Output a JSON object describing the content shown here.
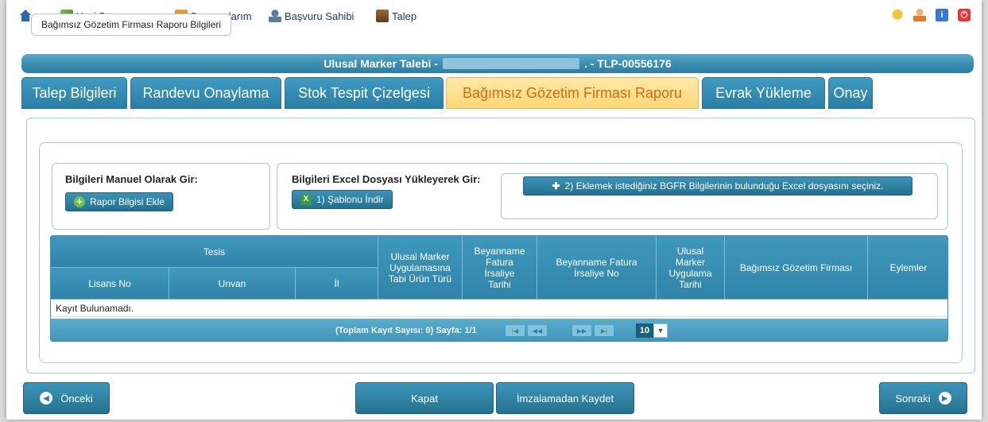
{
  "nav": {
    "home_icon": "home-icon",
    "items": [
      {
        "label": "Yeni Başvuru",
        "icon": "new-application-icon"
      },
      {
        "label": "Başvurularım",
        "icon": "applications-icon"
      },
      {
        "label": "Başvuru Sahibi",
        "icon": "applicant-icon"
      },
      {
        "label": "Talep",
        "icon": "request-icon"
      }
    ],
    "right_icons": [
      "chat-icon",
      "user-icon",
      "info-icon",
      "power-icon"
    ]
  },
  "titlebar": {
    "prefix": "Ulusal Marker Talebi -",
    "suffix": ". - TLP-00556176"
  },
  "tabs": [
    {
      "label": "Talep Bilgileri",
      "active": false
    },
    {
      "label": "Randevu Onaylama",
      "active": false
    },
    {
      "label": "Stok Tespit Çizelgesi",
      "active": false
    },
    {
      "label": "Bağımsız Gözetim Firması Raporu",
      "active": true
    },
    {
      "label": "Evrak Yükleme",
      "active": false
    },
    {
      "label": "Onay",
      "active": false
    }
  ],
  "section": {
    "legend": "Bağımsız Gözetim Firması Raporu Bilgileri",
    "manual": {
      "heading": "Bilgileri Manuel Olarak Gir:",
      "button": "Rapor Bilgisi Ekle"
    },
    "excel": {
      "heading": "Bilgileri Excel Dosyası Yükleyerek Gir:",
      "template_button": "1) Şablonu İndir",
      "upload_button": "2) Eklemek istediğiniz BGFR Bilgilerinin bulunduğu Excel dosyasını seçiniz."
    }
  },
  "grid": {
    "group_header": "Tesis",
    "columns": [
      "Lisans No",
      "Unvan",
      "İl",
      "Ulusal Marker Uygulamasına Tabi Ürün Türü",
      "Beyanname Fatura İrsaliye Tarihi",
      "Beyanname Fatura İrsaliye No",
      "Ulusal Marker Uygulama Tarihi",
      "Bağımsız Gözetim Firması",
      "Eylemler"
    ],
    "empty_text": "Kayıt Bulunamadı.",
    "pager": {
      "info": "(Toplam Kayıt Sayısı: 0) Sayfa: 1/1",
      "page_size": "10"
    }
  },
  "footer": {
    "prev": "Önceki",
    "close": "Kapat",
    "save_unsigned": "İmzalamadan Kaydet",
    "next": "Sonraki"
  },
  "colors": {
    "accent": "#2f84a8",
    "active_tab": "#fcd776",
    "active_tab_text": "#d66a12"
  }
}
